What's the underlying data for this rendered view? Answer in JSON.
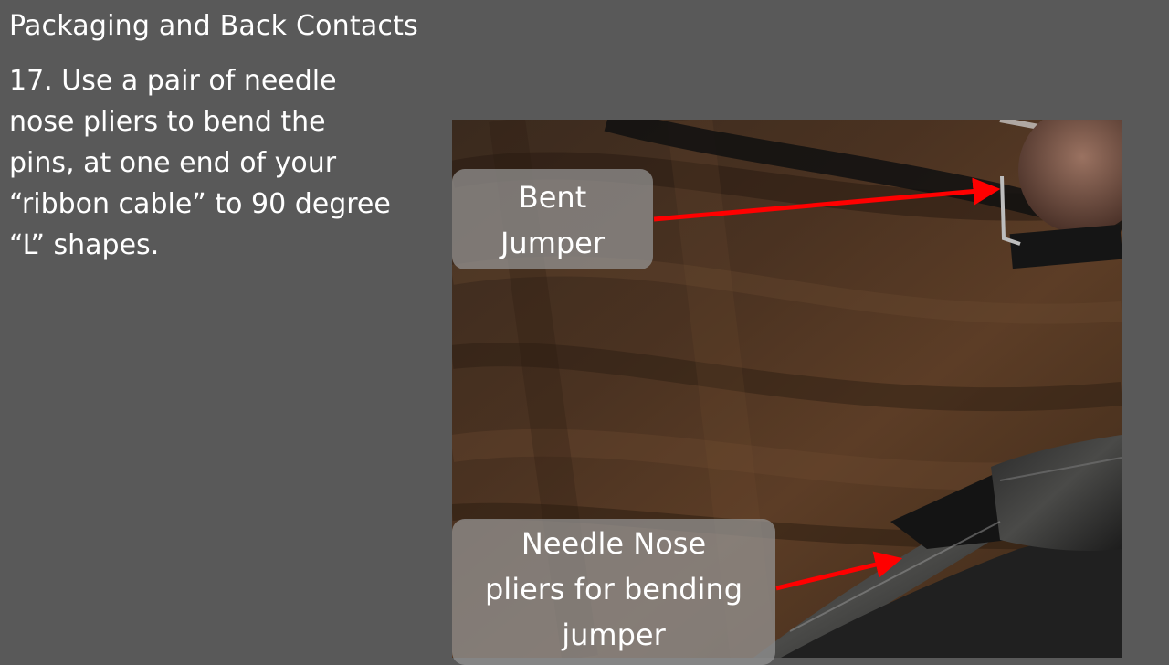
{
  "slide": {
    "title": "Packaging and Back Contacts",
    "body_lines": [
      "17. Use a pair of needle",
      "nose pliers to bend the",
      "pins, at one end of your",
      "“ribbon cable” to 90 degree",
      "“L” shapes."
    ]
  },
  "callouts": {
    "bent_jumper": {
      "lines": [
        "Bent",
        "Jumper"
      ]
    },
    "pliers": {
      "lines": [
        "Needle Nose",
        "pliers for bending",
        "jumper"
      ]
    }
  },
  "colors": {
    "background": "#595959",
    "arrow": "#ff0000",
    "callout_fill": "#969696"
  },
  "photo": {
    "subject": "pliers-bending-jumper-photo"
  }
}
